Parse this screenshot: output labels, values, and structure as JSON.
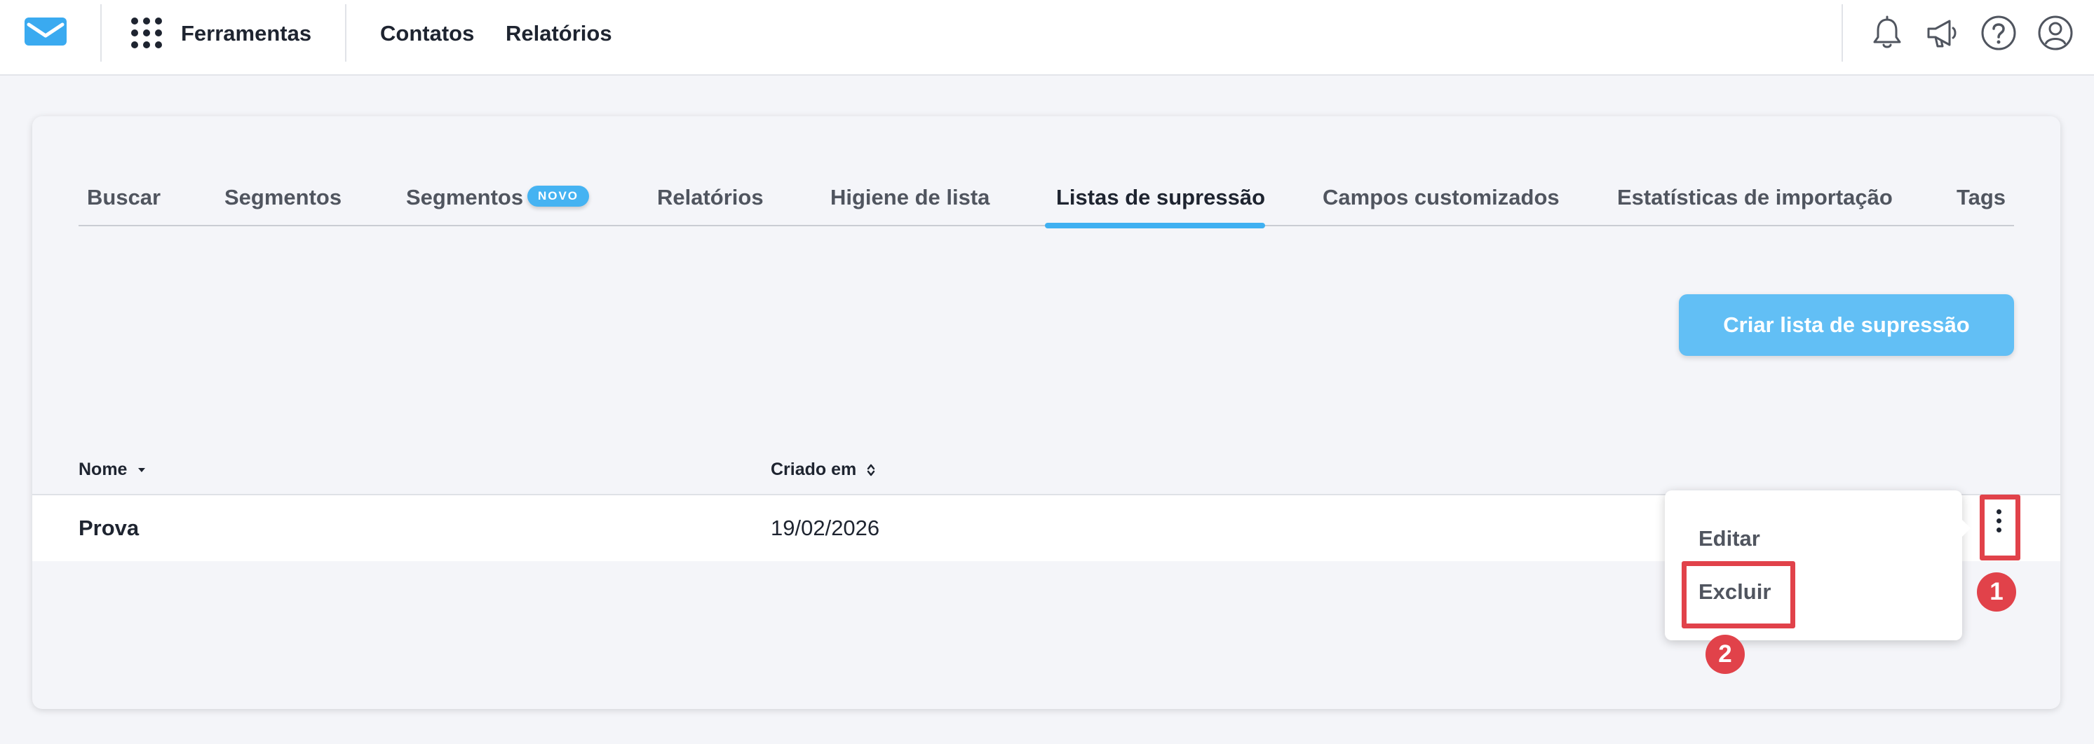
{
  "topbar": {
    "logo_icon": "envelope-logo-icon",
    "tools_icon": "apps-grid-icon",
    "tools_label": "Ferramentas",
    "nav": [
      "Contatos",
      "Relatórios"
    ],
    "icons": [
      "bell-icon",
      "megaphone-icon",
      "help-icon",
      "user-icon"
    ]
  },
  "tabs": [
    {
      "label": "Buscar"
    },
    {
      "label": "Segmentos"
    },
    {
      "label": "Segmentos",
      "badge": "NOVO"
    },
    {
      "label": "Relatórios"
    },
    {
      "label": "Higiene de lista"
    },
    {
      "label": "Listas de supressão",
      "active": true
    },
    {
      "label": "Campos customizados"
    },
    {
      "label": "Estatísticas de importação"
    },
    {
      "label": "Tags"
    }
  ],
  "create_button": "Criar lista de supressão",
  "table": {
    "columns": [
      "Nome",
      "Criado em"
    ],
    "rows": [
      {
        "name": "Prova",
        "created": "19/02/2026"
      }
    ]
  },
  "row_menu": {
    "items": [
      "Editar",
      "Excluir"
    ]
  },
  "annotations": [
    "1",
    "2"
  ],
  "colors": {
    "accent": "#3fb0f1",
    "button": "#62bff5",
    "annotation": "#e1424a",
    "text": "#1e2430"
  }
}
